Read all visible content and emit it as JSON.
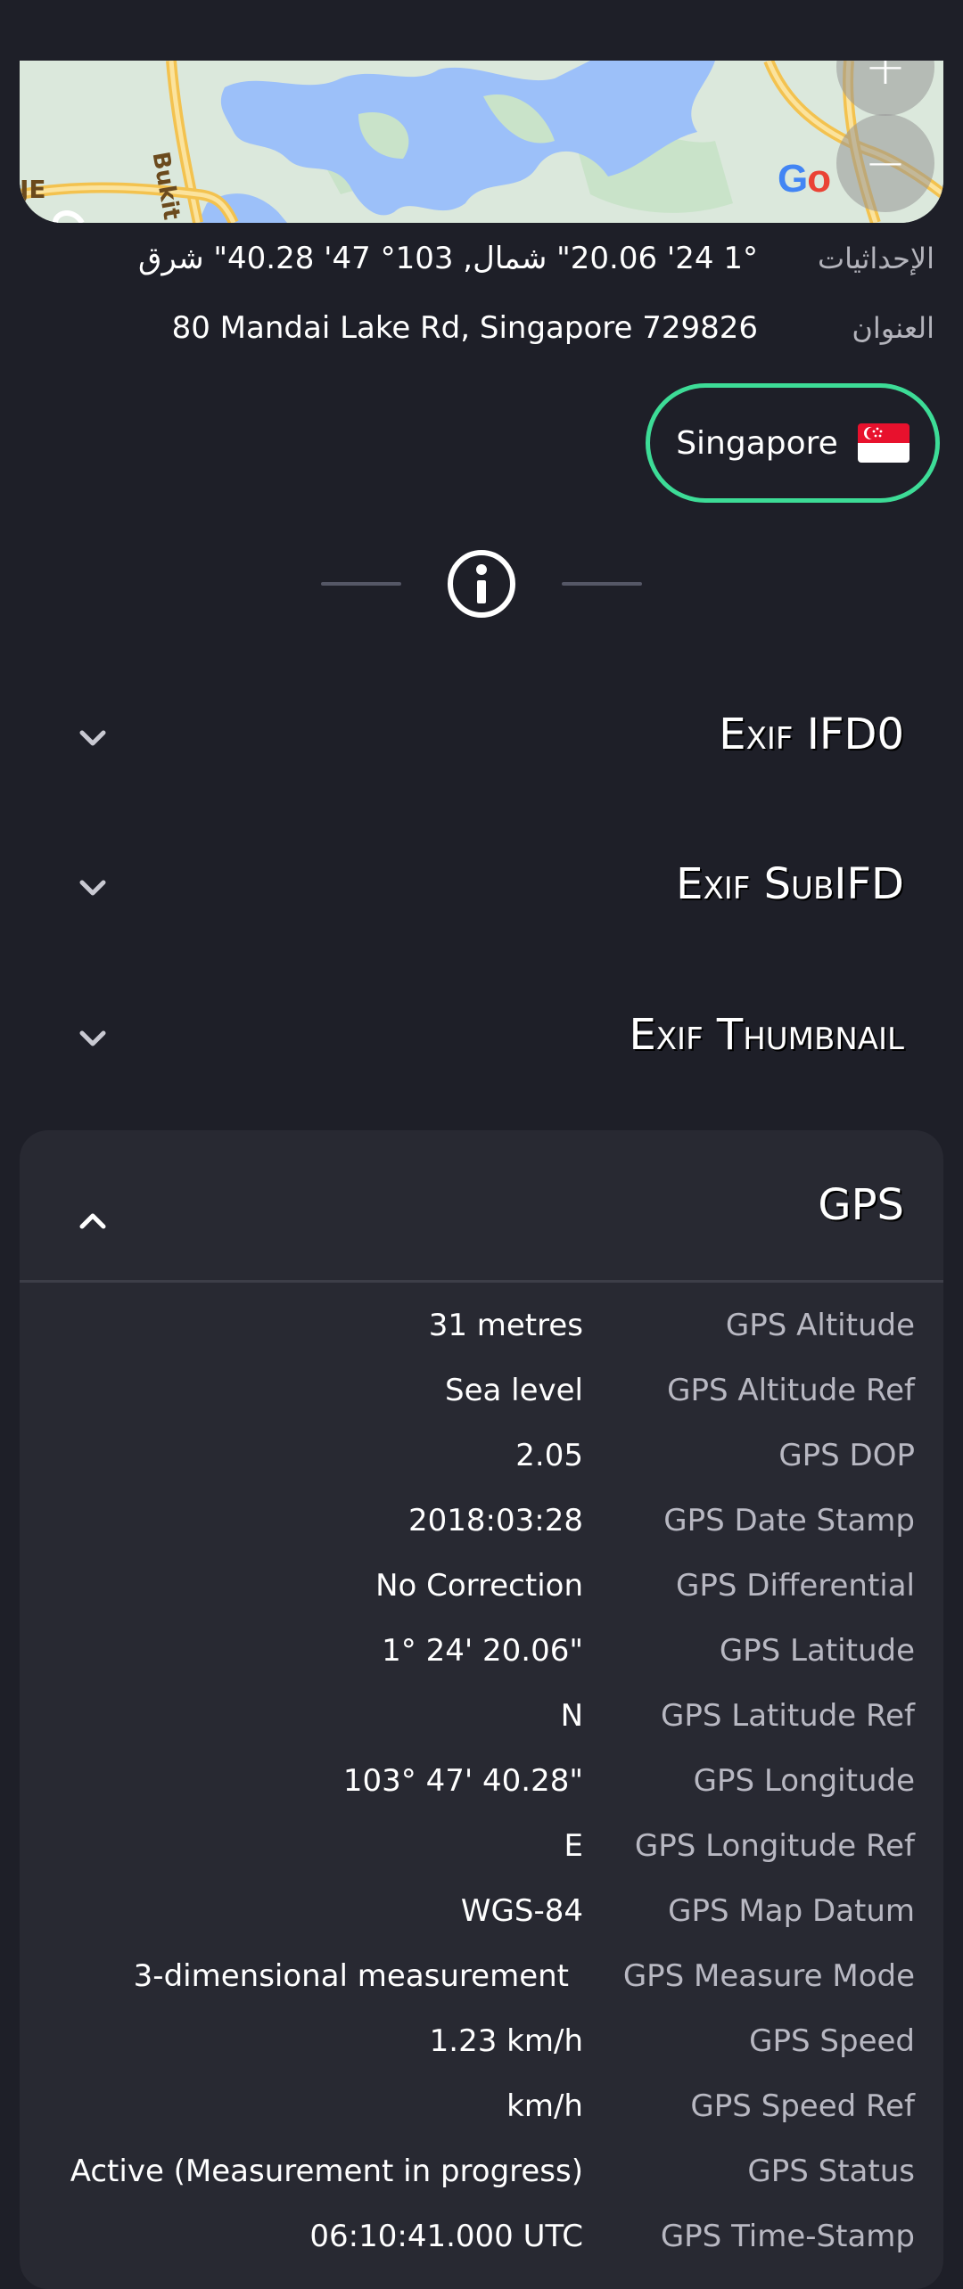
{
  "map": {
    "road_label_1": "Bukit",
    "road_label_2": "JE",
    "logo_text": "Go",
    "zoom_in_label": "+",
    "zoom_out_label": "−"
  },
  "info": {
    "coordinates_label": "الإحداثيات",
    "coordinates_value": "1° 24' 20.06\" شمال, 103° 47' 40.28\" شرق",
    "address_label": "العنوان",
    "address_value": "80 Mandai Lake Rd, Singapore 729826"
  },
  "country": {
    "name": "Singapore",
    "flag": "singapore-flag"
  },
  "sections": [
    {
      "title": "Exif IFD0",
      "highlight": "#e8df3a",
      "expanded": false
    },
    {
      "title": "Exif SubIFD",
      "highlight": "#5b46e8",
      "expanded": false
    },
    {
      "title": "Exif Thumbnail",
      "highlight": "#4b57e8",
      "expanded": false
    }
  ],
  "gps": {
    "title": "GPS",
    "highlight": "#4b57e8",
    "expanded": true,
    "rows": [
      {
        "key": "GPS Altitude",
        "value": "31 metres"
      },
      {
        "key": "GPS Altitude Ref",
        "value": "Sea level"
      },
      {
        "key": "GPS DOP",
        "value": "2.05"
      },
      {
        "key": "GPS Date Stamp",
        "value": "2018:03:28"
      },
      {
        "key": "GPS Differential",
        "value": "No Correction"
      },
      {
        "key": "GPS Latitude",
        "value": "1° 24' 20.06\""
      },
      {
        "key": "GPS Latitude Ref",
        "value": "N"
      },
      {
        "key": "GPS Longitude",
        "value": "103° 47' 40.28\""
      },
      {
        "key": "GPS Longitude Ref",
        "value": "E"
      },
      {
        "key": "GPS Map Datum",
        "value": "WGS-84"
      },
      {
        "key": "GPS Measure Mode",
        "value": "3-dimensional measurement"
      },
      {
        "key": "GPS Speed",
        "value": "1.23 km/h"
      },
      {
        "key": "GPS Speed Ref",
        "value": "km/h"
      },
      {
        "key": "GPS Status",
        "value": "Active (Measurement in progress)"
      },
      {
        "key": "GPS Time-Stamp",
        "value": "06:10:41.000 UTC"
      }
    ]
  }
}
